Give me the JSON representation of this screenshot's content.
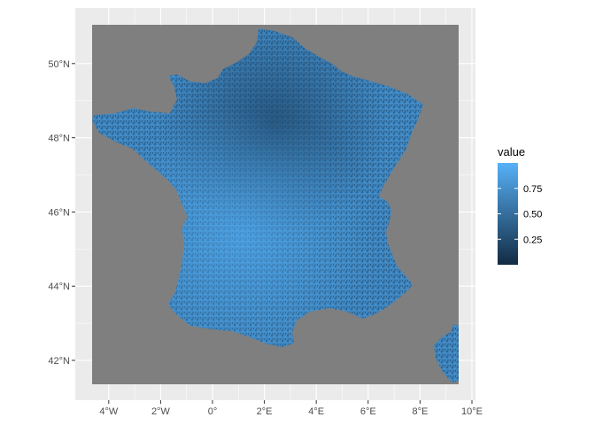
{
  "chart_data": {
    "type": "heatmap",
    "title": "",
    "xlabel": "",
    "ylabel": "",
    "x_ticks": [
      {
        "value": -4,
        "label": "4°W"
      },
      {
        "value": -2,
        "label": "2°W"
      },
      {
        "value": 0,
        "label": "0°"
      },
      {
        "value": 2,
        "label": "2°E"
      },
      {
        "value": 4,
        "label": "4°E"
      },
      {
        "value": 6,
        "label": "6°E"
      },
      {
        "value": 8,
        "label": "8°E"
      },
      {
        "value": 10,
        "label": "10°E"
      }
    ],
    "y_ticks": [
      {
        "value": 42,
        "label": "42°N"
      },
      {
        "value": 44,
        "label": "44°N"
      },
      {
        "value": 46,
        "label": "46°N"
      },
      {
        "value": 48,
        "label": "48°N"
      },
      {
        "value": 50,
        "label": "50°N"
      }
    ],
    "xlim": [
      -5.4,
      10.3
    ],
    "ylim": [
      41.1,
      51.4
    ],
    "grid": true,
    "region": "France",
    "legend": {
      "title": "value",
      "position": "right",
      "breaks": [
        {
          "value": 0.75,
          "label": "0.75"
        },
        {
          "value": 0.5,
          "label": "0.50"
        },
        {
          "value": 0.25,
          "label": "0.25"
        }
      ],
      "range": [
        0.0,
        1.0
      ],
      "low_color": "#132B43",
      "high_color": "#56B1F7"
    },
    "colors": {
      "panel_background": "#EBEBEB",
      "grid": "#FFFFFF",
      "na_fill": "#7F7F7F"
    }
  }
}
